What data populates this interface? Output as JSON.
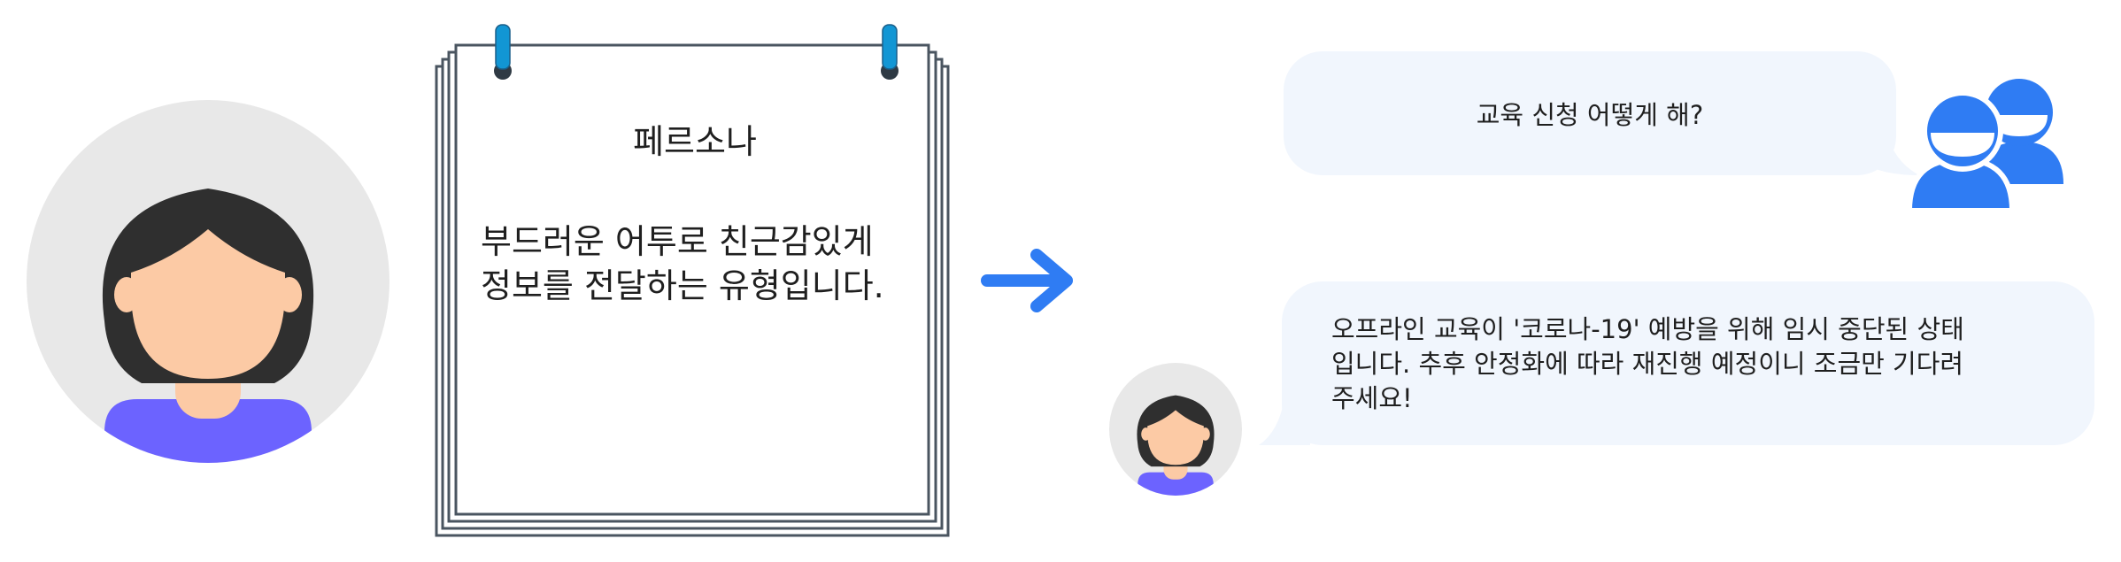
{
  "persona_card": {
    "title": "페르소나",
    "description_lines": [
      "부드러운 어투로 친근감있게",
      "정보를 전달하는 유형입니다."
    ]
  },
  "chat": {
    "user_message": "교육 신청 어떻게 해?",
    "bot_message_lines": [
      "오프라인 교육이 '코로나-19' 예방을 위해 임시 중단된 상태",
      "입니다. 추후 안정화에 따라 재진행 예정이니 조금만 기다려",
      "주세요!"
    ]
  },
  "colors": {
    "avatar_background": "#e8e8e8",
    "skin": "#fccaa5",
    "hair": "#2f2f2f",
    "shirt": "#6c63ff",
    "accent_blue": "#2f7cf3",
    "bubble": "#f1f6fd",
    "notepad_border": "#4a5560",
    "ring_blue": "#1296d4"
  },
  "icons": {
    "persona": "female-avatar-icon",
    "notepad": "notepad-icon",
    "arrow": "arrow-right-icon",
    "users": "users-icon",
    "bot": "female-avatar-icon"
  }
}
